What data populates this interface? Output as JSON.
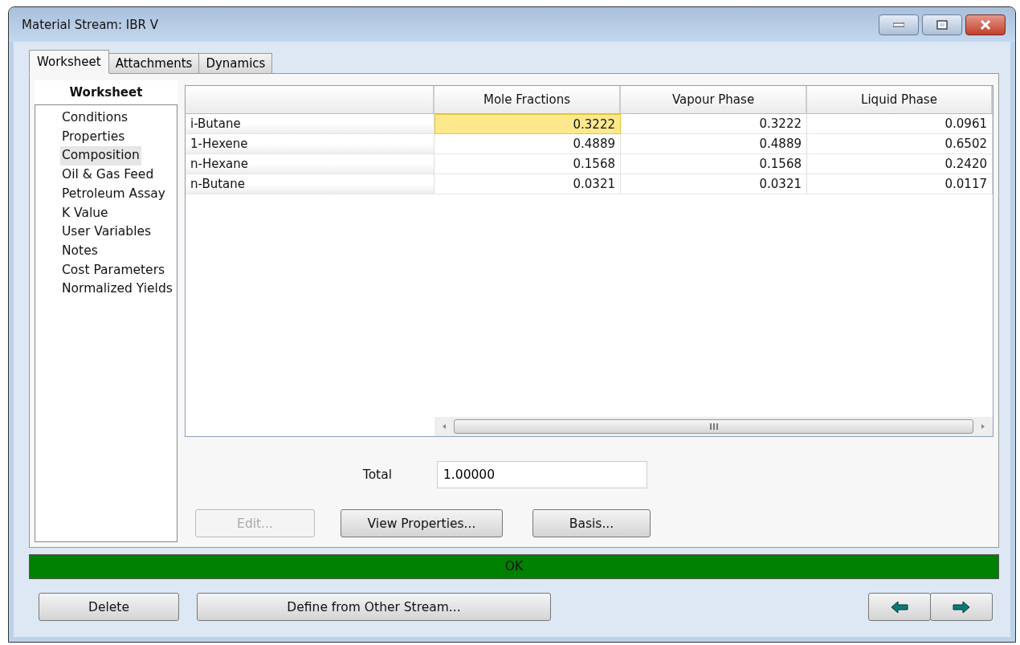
{
  "window": {
    "title": "Material Stream: IBR V"
  },
  "tabs": [
    {
      "label": "Worksheet",
      "selected": true
    },
    {
      "label": "Attachments",
      "selected": false
    },
    {
      "label": "Dynamics",
      "selected": false
    }
  ],
  "sidebar": {
    "heading": "Worksheet",
    "items": [
      {
        "label": "Conditions",
        "selected": false
      },
      {
        "label": "Properties",
        "selected": false
      },
      {
        "label": "Composition",
        "selected": true
      },
      {
        "label": "Oil & Gas Feed",
        "selected": false
      },
      {
        "label": "Petroleum Assay",
        "selected": false
      },
      {
        "label": "K Value",
        "selected": false
      },
      {
        "label": "User Variables",
        "selected": false
      },
      {
        "label": "Notes",
        "selected": false
      },
      {
        "label": "Cost Parameters",
        "selected": false
      },
      {
        "label": "Normalized Yields",
        "selected": false
      }
    ]
  },
  "table": {
    "columns": [
      "Mole Fractions",
      "Vapour Phase",
      "Liquid Phase"
    ],
    "rows": [
      {
        "name": "i-Butane",
        "cells": [
          {
            "value": "0.3222",
            "selected": true
          },
          {
            "value": "0.3222",
            "selected": false
          },
          {
            "value": "0.0961",
            "selected": false
          }
        ]
      },
      {
        "name": "1-Hexene",
        "cells": [
          {
            "value": "0.4889",
            "selected": false
          },
          {
            "value": "0.4889",
            "selected": false
          },
          {
            "value": "0.6502",
            "selected": false
          }
        ]
      },
      {
        "name": "n-Hexane",
        "cells": [
          {
            "value": "0.1568",
            "selected": false
          },
          {
            "value": "0.1568",
            "selected": false
          },
          {
            "value": "0.2420",
            "selected": false
          }
        ]
      },
      {
        "name": "n-Butane",
        "cells": [
          {
            "value": "0.0321",
            "selected": false
          },
          {
            "value": "0.0321",
            "selected": false
          },
          {
            "value": "0.0117",
            "selected": false
          }
        ]
      }
    ]
  },
  "total": {
    "label": "Total",
    "value": "1.00000"
  },
  "actions": [
    {
      "label": "Edit...",
      "disabled": true
    },
    {
      "label": "View Properties...",
      "disabled": false
    },
    {
      "label": "Basis...",
      "disabled": false
    }
  ],
  "status_bar": {
    "text": "OK"
  },
  "footer_buttons": [
    "Delete",
    "Define from Other Stream..."
  ]
}
